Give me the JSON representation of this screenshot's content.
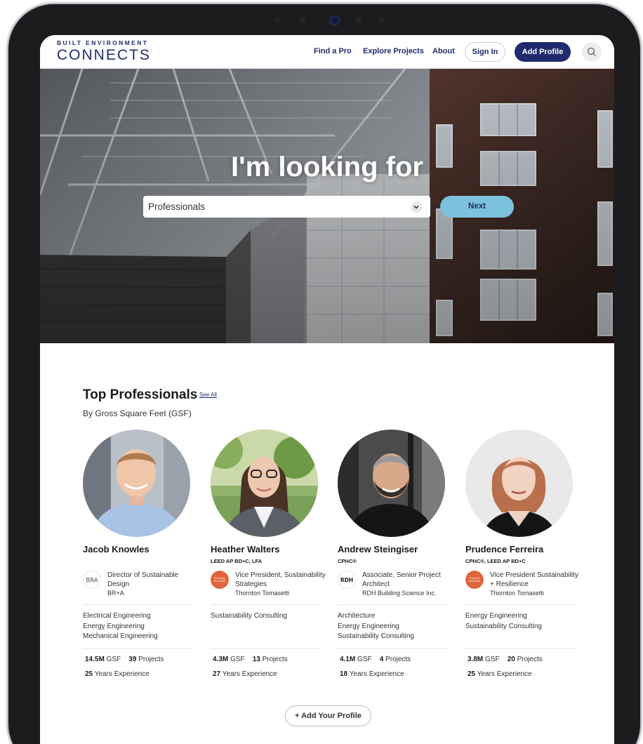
{
  "brand": {
    "top": "BUILT ENVIRONMENT",
    "main": "CONNECTS"
  },
  "nav": {
    "find_pro": "Find a Pro",
    "explore": "Explore Projects",
    "about": "About",
    "sign_in": "Sign In",
    "add_profile": "Add Profile",
    "search_icon": "search-icon"
  },
  "hero": {
    "title": "I'm looking for",
    "select_value": "Professionals",
    "next_label": "Next"
  },
  "section": {
    "title": "Top Professionals",
    "see_all": "See All",
    "subtitle": "By Gross Square Feet (GSF)"
  },
  "professionals": [
    {
      "name": "Jacob Knowles",
      "credentials": "",
      "role": "Director of Sustainable Design",
      "company": "BR+A",
      "logo_text": "BR+A",
      "specialties": [
        "Electrical Engineering",
        "Energy Engineering",
        "Mechanical Engineering"
      ],
      "gsf": "14.5M",
      "gsf_unit": "GSF",
      "projects": "39",
      "projects_label": "Projects",
      "years": "25",
      "years_label": "Years Experience"
    },
    {
      "name": "Heather Walters",
      "credentials": "LEED AP BD+C, LFA",
      "role": "Vice President, Sustainability Strategies",
      "company": "Thornton Tomasetti",
      "logo_text": "Thornton Tomasetti",
      "specialties": [
        "Sustainability Consulting"
      ],
      "gsf": "4.3M",
      "gsf_unit": "GSF",
      "projects": "13",
      "projects_label": "Projects",
      "years": "27",
      "years_label": "Years Experience"
    },
    {
      "name": "Andrew Steingiser",
      "credentials": "CPHC®",
      "role": "Associate, Senior Project Architect",
      "company": "RDH Building Science Inc.",
      "logo_text": "RDH",
      "specialties": [
        "Architecture",
        "Energy Engineering",
        "Sustainability Consulting"
      ],
      "gsf": "4.1M",
      "gsf_unit": "GSF",
      "projects": "4",
      "projects_label": "Projects",
      "years": "18",
      "years_label": "Years Experience"
    },
    {
      "name": "Prudence Ferreira",
      "credentials": "CPHC®, LEED AP BD+C",
      "role": "Vice President Sustainability + Resilience",
      "company": "Thornton Tomasetti",
      "logo_text": "Thornton Tomasetti",
      "specialties": [
        "Energy Engineering",
        "Sustainability Consulting"
      ],
      "gsf": "3.8M",
      "gsf_unit": "GSF",
      "projects": "20",
      "projects_label": "Projects",
      "years": "25",
      "years_label": "Years Experience"
    }
  ],
  "cta": {
    "add_your_profile": "+ Add Your Profile"
  },
  "colors": {
    "brand_navy": "#1f2b6e",
    "next_button": "#7cc2dc",
    "thornton_orange": "#e0643c"
  }
}
